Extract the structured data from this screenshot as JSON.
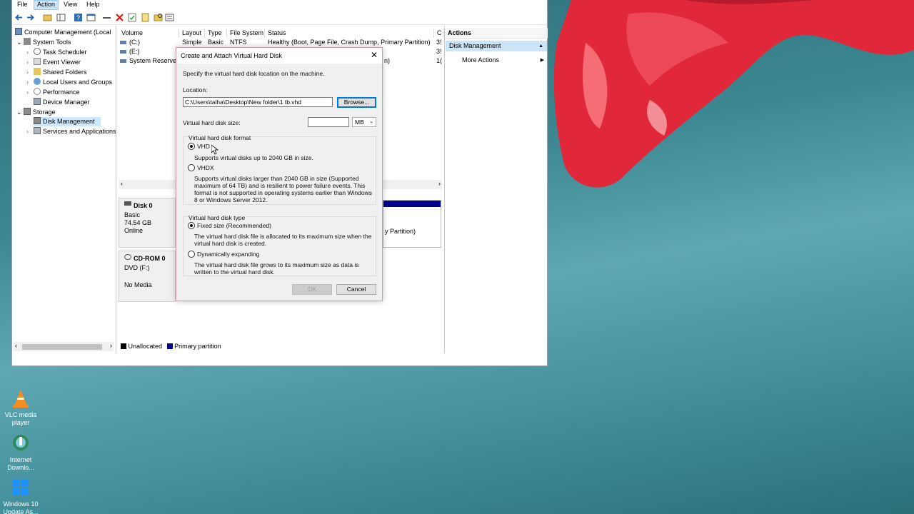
{
  "menu": {
    "file": "File",
    "action": "Action",
    "view": "View",
    "help": "Help"
  },
  "tree": {
    "root": "Computer Management (Local",
    "items": [
      {
        "label": "System Tools"
      },
      {
        "label": "Task Scheduler"
      },
      {
        "label": "Event Viewer"
      },
      {
        "label": "Shared Folders"
      },
      {
        "label": "Local Users and Groups"
      },
      {
        "label": "Performance"
      },
      {
        "label": "Device Manager"
      },
      {
        "label": "Storage"
      },
      {
        "label": "Disk Management"
      },
      {
        "label": "Services and Applications"
      }
    ]
  },
  "volume_table": {
    "headers": [
      "Volume",
      "Layout",
      "Type",
      "File System",
      "Status",
      "C"
    ],
    "rows": [
      {
        "volume": "(C:)",
        "layout": "Simple",
        "type": "Basic",
        "fs": "NTFS",
        "status": "Healthy (Boot, Page File, Crash Dump, Primary Partition)",
        "c": "3!"
      },
      {
        "volume": "(E:)",
        "layout": "",
        "type": "",
        "fs": "",
        "status": "",
        "c": "3!"
      },
      {
        "volume": "System Reserved",
        "layout": "",
        "type": "",
        "fs": "",
        "status": "n)",
        "c": "1("
      }
    ]
  },
  "disks": {
    "disk0": {
      "name": "Disk 0",
      "kind": "Basic",
      "size": "74.54 GB",
      "state": "Online",
      "partition_fragment": "y Partition)"
    },
    "cdrom0": {
      "name": "CD-ROM 0",
      "drive": "DVD (F:)",
      "media": "No Media"
    }
  },
  "legend": {
    "unallocated": "Unallocated",
    "primary": "Primary partition"
  },
  "actions": {
    "header": "Actions",
    "section": "Disk Management",
    "more": "More Actions"
  },
  "dialog": {
    "title": "Create and Attach Virtual Hard Disk",
    "intro": "Specify the virtual hard disk location on the machine.",
    "location_label": "Location:",
    "location_value": "C:\\Users\\talha\\Desktop\\New folder\\1 tb.vhd",
    "browse": "Browse...",
    "size_label": "Virtual hard disk size:",
    "size_value": "",
    "size_unit": "MB",
    "format_label": "Virtual hard disk format",
    "vhd_label": "VHD",
    "vhd_desc": "Supports virtual disks up to 2040 GB in size.",
    "vhdx_label": "VHDX",
    "vhdx_desc": "Supports virtual disks larger than 2040 GB in size (Supported maximum of 64 TB) and is resilient to power failure events. This format is not supported in operating systems earlier than Windows 8 or Windows Server 2012.",
    "type_label": "Virtual hard disk type",
    "fixed_label": "Fixed size (Recommended)",
    "fixed_desc": "The virtual hard disk file is allocated to its maximum size when the virtual hard disk is created.",
    "dynamic_label": "Dynamically expanding",
    "dynamic_desc": "The virtual hard disk file grows to its maximum size as data is written to the virtual hard disk.",
    "ok": "OK",
    "cancel": "Cancel",
    "format_selected": "VHD",
    "type_selected": "Fixed size (Recommended)"
  },
  "desktop_icons": [
    {
      "label": "VLC media player"
    },
    {
      "label": "Internet Downlo..."
    },
    {
      "label": "Windows 10 Update As..."
    }
  ],
  "colors": {
    "accent": "#0078d7",
    "selection": "#cce8ff",
    "primary_partition": "#00008b"
  }
}
